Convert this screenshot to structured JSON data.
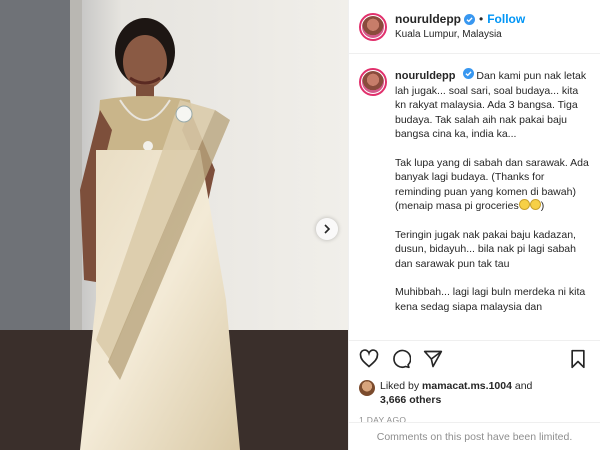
{
  "header": {
    "username": "nouruldepp",
    "follow_label": "Follow",
    "separator": "•",
    "location": "Kuala Lumpur, Malaysia"
  },
  "caption": {
    "username": "nouruldepp",
    "paragraph1": "Dan kami pun nak letak lah jugak... soal sari, soal budaya... kita kn rakyat malaysia. Ada 3 bangsa. Tiga budaya. Tak salah aih nak pakai baju bangsa cina ka, india ka...",
    "paragraph2": "Tak lupa yang di sabah dan sarawak. Ada banyak lagi budaya. (Thanks for reminding puan yang komen di bawah) (menaip masa pi groceries",
    "paragraph3": "Teringin jugak nak pakai baju kadazan, dusun, bidayuh... bila nak pi lagi sabah dan sarawak pun tak tau",
    "paragraph4": "Muhibbah... lagi lagi buln merdeka ni kita kena sedag siapa malaysia dan"
  },
  "likes": {
    "prefix": "Liked by",
    "liker": "mamacat.ms.1004",
    "conjunction": "and",
    "others": "3,666 others"
  },
  "timestamp": "1 DAY AGO",
  "comments_notice": "Comments on this post have been limited.",
  "icons": {
    "verified": "verified-badge-icon",
    "like": "heart-icon",
    "comment": "comment-icon",
    "share": "send-icon",
    "save": "bookmark-icon",
    "next": "chevron-right-icon"
  },
  "colors": {
    "link": "#0095f6",
    "text": "#262626",
    "muted": "#8e8e8e",
    "story_ring": "#e1306c"
  }
}
